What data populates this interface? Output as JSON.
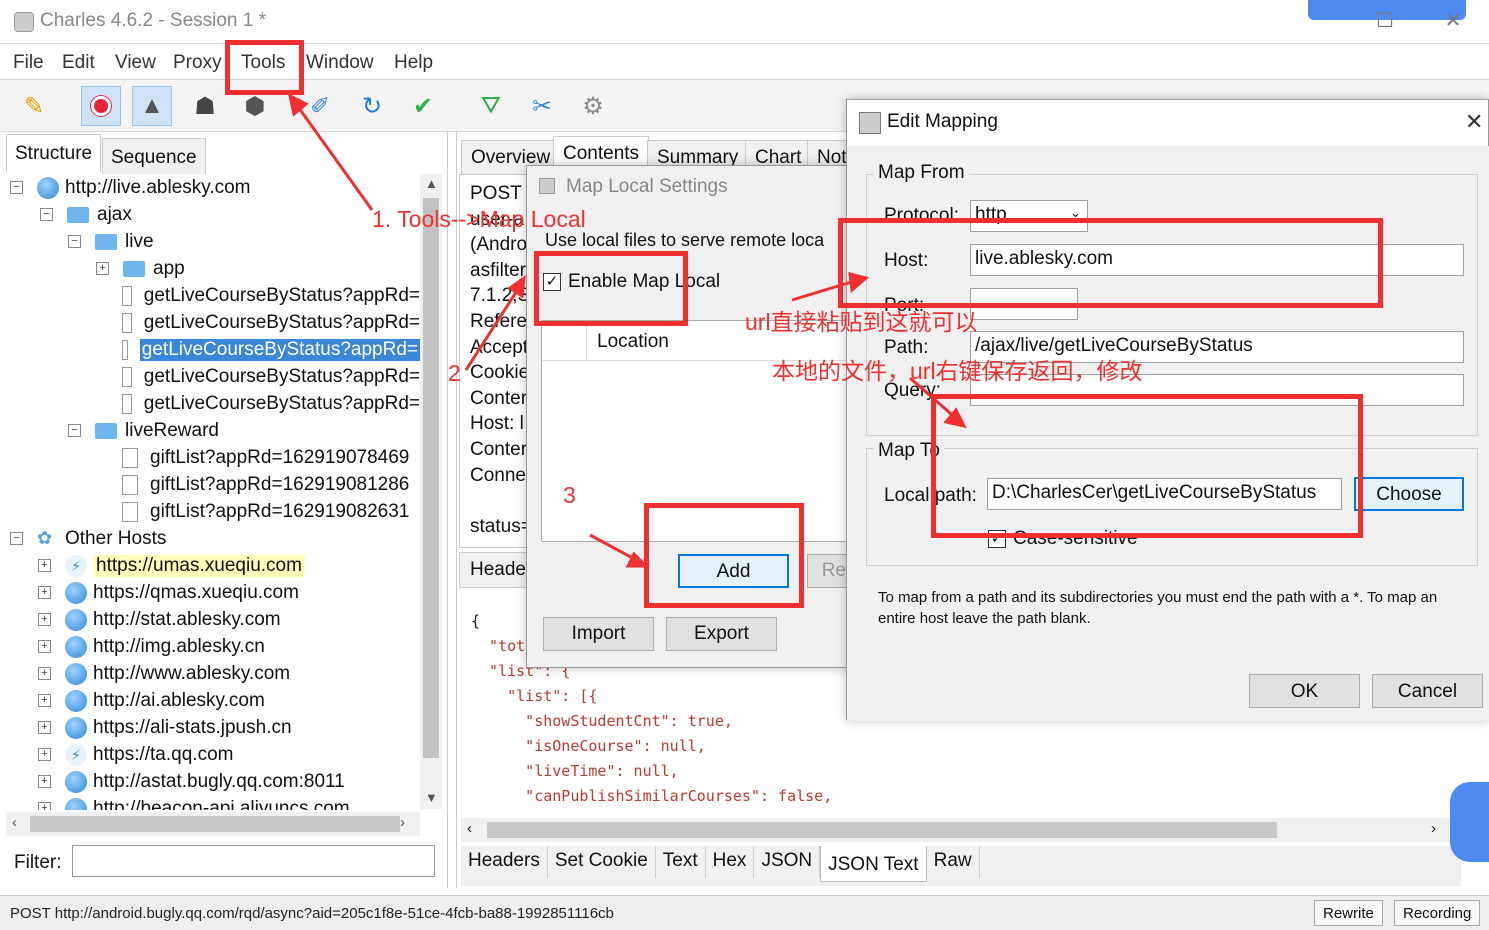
{
  "window": {
    "title": "Charles 4.6.2 - Session 1 *",
    "minimize": "—",
    "maximize": "☐",
    "close": "✕"
  },
  "menu": [
    "File",
    "Edit",
    "View",
    "Proxy",
    "Tools",
    "Window",
    "Help"
  ],
  "toolbar": {
    "icons": [
      "broom-icon",
      "record-icon",
      "throttle-icon",
      "turtle-icon",
      "stop-icon",
      "pen-icon",
      "refresh-icon",
      "check-icon",
      "basket-icon",
      "tools-icon",
      "settings-icon"
    ]
  },
  "left": {
    "tabs": [
      "Structure",
      "Sequence"
    ],
    "tree": [
      {
        "label": "http://live.ablesky.com"
      },
      {
        "label": "ajax"
      },
      {
        "label": "live"
      },
      {
        "label": "app"
      },
      {
        "label": "getLiveCourseByStatus?appRd="
      },
      {
        "label": "getLiveCourseByStatus?appRd="
      },
      {
        "label": "getLiveCourseByStatus?appRd="
      },
      {
        "label": "getLiveCourseByStatus?appRd="
      },
      {
        "label": "getLiveCourseByStatus?appRd="
      },
      {
        "label": "liveReward"
      },
      {
        "label": "giftList?appRd=162919078469"
      },
      {
        "label": "giftList?appRd=162919081286"
      },
      {
        "label": "giftList?appRd=162919082631"
      },
      {
        "label": "Other Hosts"
      },
      {
        "label": "https://umas.xueqiu.com"
      },
      {
        "label": "https://qmas.xueqiu.com"
      },
      {
        "label": "http://stat.ablesky.com"
      },
      {
        "label": "http://img.ablesky.cn"
      },
      {
        "label": "http://www.ablesky.com"
      },
      {
        "label": "http://ai.ablesky.com"
      },
      {
        "label": "https://ali-stats.jpush.cn"
      },
      {
        "label": "https://ta.qq.com"
      },
      {
        "label": "http://astat.bugly.qq.com:8011"
      },
      {
        "label": "http://beacon-api.aliyuncs.com"
      }
    ],
    "filter_label": "Filter:"
  },
  "right": {
    "tabs": [
      "Overview",
      "Contents",
      "Summary",
      "Chart",
      "Not"
    ],
    "request_lines": [
      "POST /",
      "user-a",
      "(Andro",
      "asfilter",
      "7.1.2;S",
      "Refere",
      "Accept",
      "Cookie",
      "Conter",
      "Host: l",
      "Conter",
      "Conne",
      "",
      "status="
    ],
    "header_label": "Heade",
    "json_lines": [
      {
        "t": "{"
      },
      {
        "t": "  \"tota",
        "k": true
      },
      {
        "t": "  \"list\": {",
        "k": true
      },
      {
        "t": "    \"list\": [{",
        "k": true
      },
      {
        "t": "      \"showStudentCnt\": true,",
        "k": true
      },
      {
        "t": "      \"isOneCourse\": null,",
        "k": true
      },
      {
        "t": "      \"liveTime\": null,",
        "k": true
      },
      {
        "t": "      \"canPublishSimilarCourses\": false,",
        "k": true
      }
    ],
    "bottom_tabs": [
      "Headers",
      "Set Cookie",
      "Text",
      "Hex",
      "JSON",
      "JSON Text",
      "Raw"
    ]
  },
  "map_local": {
    "title": "Map Local Settings",
    "description": "Use local files to serve remote loca",
    "enable_label": "Enable Map Local",
    "enabled": true,
    "column_location": "Location",
    "add": "Add",
    "remove": "Rer",
    "import": "Import",
    "export": "Export"
  },
  "edit_mapping": {
    "title": "Edit Mapping",
    "map_from": "Map From",
    "protocol_label": "Protocol:",
    "protocol_value": "http",
    "host_label": "Host:",
    "host_value": "live.ablesky.com",
    "port_label": "Port:",
    "port_value": "",
    "path_label": "Path:",
    "path_value": "/ajax/live/getLiveCourseByStatus",
    "query_label": "Query:",
    "query_value": "",
    "map_to": "Map To",
    "local_path_label": "Local path:",
    "local_path_value": "D:\\CharlesCer\\getLiveCourseByStatus",
    "choose": "Choose",
    "case_sensitive": "Case-sensitive",
    "case_checked": true,
    "help": "To map from a path and its subdirectories you must end the path with a *. To map an entire host leave the path blank.",
    "ok": "OK",
    "cancel": "Cancel"
  },
  "annotations": {
    "step1": "1. Tools-->Map Local",
    "step2": "2",
    "step3": "3",
    "url_note": "url直接粘贴到这就可以",
    "file_note": "本地的文件，url右键保存返回，修改"
  },
  "status": {
    "text": "POST http://android.bugly.qq.com/rqd/async?aid=205c1f8e-51ce-4fcb-ba88-1992851116cb",
    "rewrite": "Rewrite",
    "recording": "Recording"
  },
  "colors": {
    "selection": "#3a86d8",
    "annotation": "#f03030",
    "highlight": "#fffbb8"
  }
}
